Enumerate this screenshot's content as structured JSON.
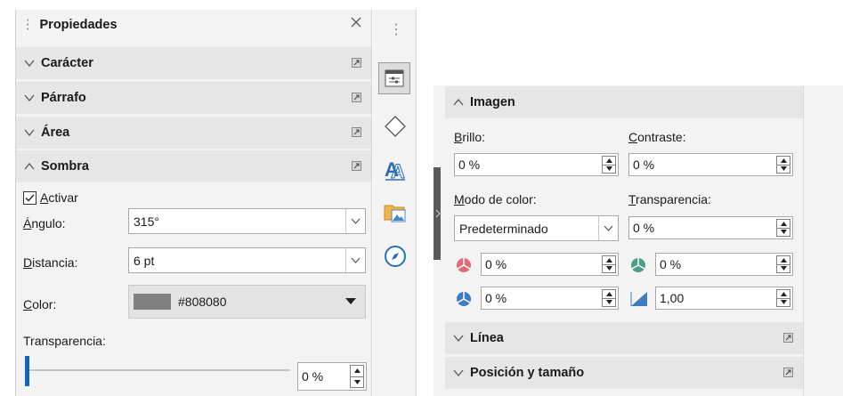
{
  "left_panel": {
    "title": "Propiedades",
    "sections": {
      "caracter": "Carácter",
      "parrafo": "Párrafo",
      "area": "Área",
      "sombra": "Sombra"
    },
    "shadow": {
      "enable_label": "Activar",
      "enable_checked": true,
      "angle_label": "Ángulo:",
      "angle_value": "315°",
      "distance_label": "Distancia:",
      "distance_value": "6 pt",
      "color_label": "Color:",
      "color_name": "#808080",
      "color_hex": "#808080",
      "transparency_label": "Transparencia:",
      "transparency_value": "0 %",
      "transparency_level": 0
    }
  },
  "right_panel": {
    "imagen_title": "Imagen",
    "brightness_label": "Brillo:",
    "brightness_value": "0 %",
    "contrast_label": "Contraste:",
    "contrast_value": "0 %",
    "color_mode_label": "Modo de color:",
    "color_mode_value": "Predeterminado",
    "transparency_label": "Transparencia:",
    "transparency_value": "0 %",
    "red_value": "0 %",
    "green_value": "0 %",
    "blue_value": "0 %",
    "gamma_value": "1,00",
    "linea_title": "Línea",
    "posicion_title": "Posición y tamaño"
  },
  "colors": {
    "accent_blue": "#1565c0",
    "section_bg": "#e6e6e6",
    "panel_bg": "#f3f3f3"
  },
  "icons": [
    "close-icon",
    "more-options-icon",
    "properties-icon",
    "styles-icon",
    "fontwork-icon",
    "gallery-icon",
    "navigator-icon"
  ]
}
